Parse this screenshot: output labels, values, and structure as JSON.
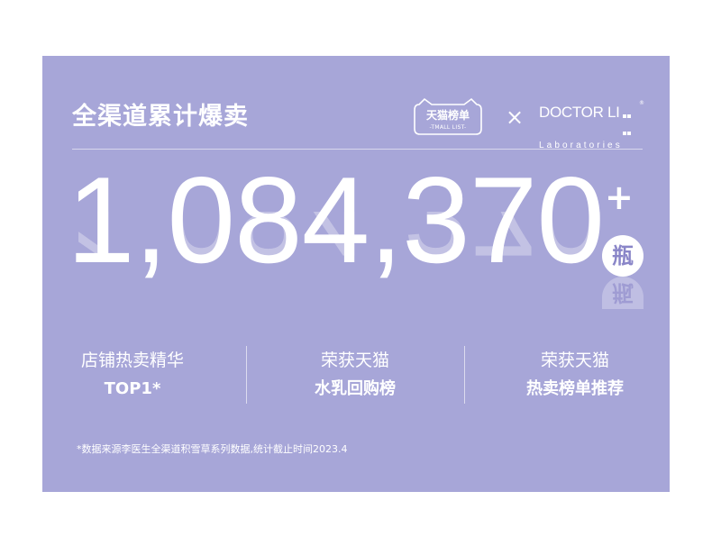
{
  "header": {
    "title": "全渠道累计爆卖",
    "tmall_badge": {
      "main": "天猫榜单",
      "sub": "-TMALL LIST-"
    },
    "cross": "×",
    "brand": {
      "name": "DOCTOR LI",
      "reg": "®",
      "sub": "Laboratories"
    }
  },
  "hero": {
    "number": "1,084,370",
    "plus": "+",
    "unit": "瓶"
  },
  "stats": [
    {
      "line1": "店铺热卖精华",
      "line2": "TOP1*"
    },
    {
      "line1": "荣获天猫",
      "line2": "水乳回购榜"
    },
    {
      "line1": "荣获天猫",
      "line2": "热卖榜单推荐"
    }
  ],
  "footnote": "*数据来源李医生全渠道积雪草系列数据,统计截止时间2023.4",
  "colors": {
    "background": "#a7a6d8",
    "text": "#ffffff",
    "unit_text": "#8a86c8"
  }
}
